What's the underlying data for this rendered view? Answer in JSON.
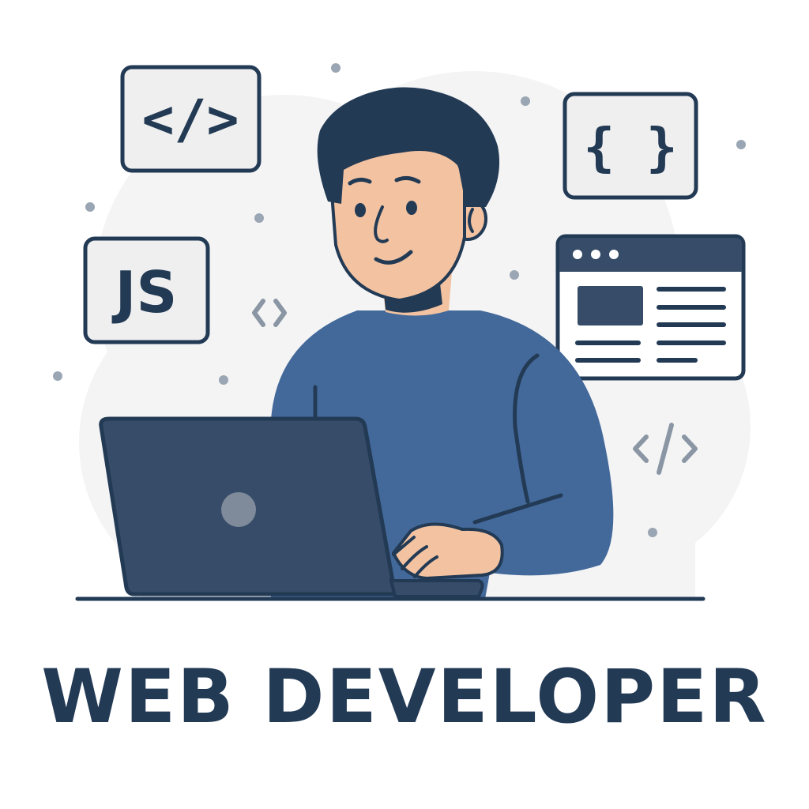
{
  "title": "WEB DEVELOPER",
  "badges": {
    "html_tag": "</>",
    "braces": "{ }",
    "js": "JS"
  },
  "colors": {
    "navy": "#233a55",
    "sweater": "#43699a",
    "skin": "#f3c3a1",
    "laptop": "#364c68",
    "badge_fill": "#efefef",
    "dots": "#9aa6b3",
    "background_blob": "#f4f4f5"
  },
  "icons": [
    "html-code-icon",
    "curly-braces-icon",
    "javascript-icon",
    "browser-window-icon",
    "small-code-icon"
  ]
}
